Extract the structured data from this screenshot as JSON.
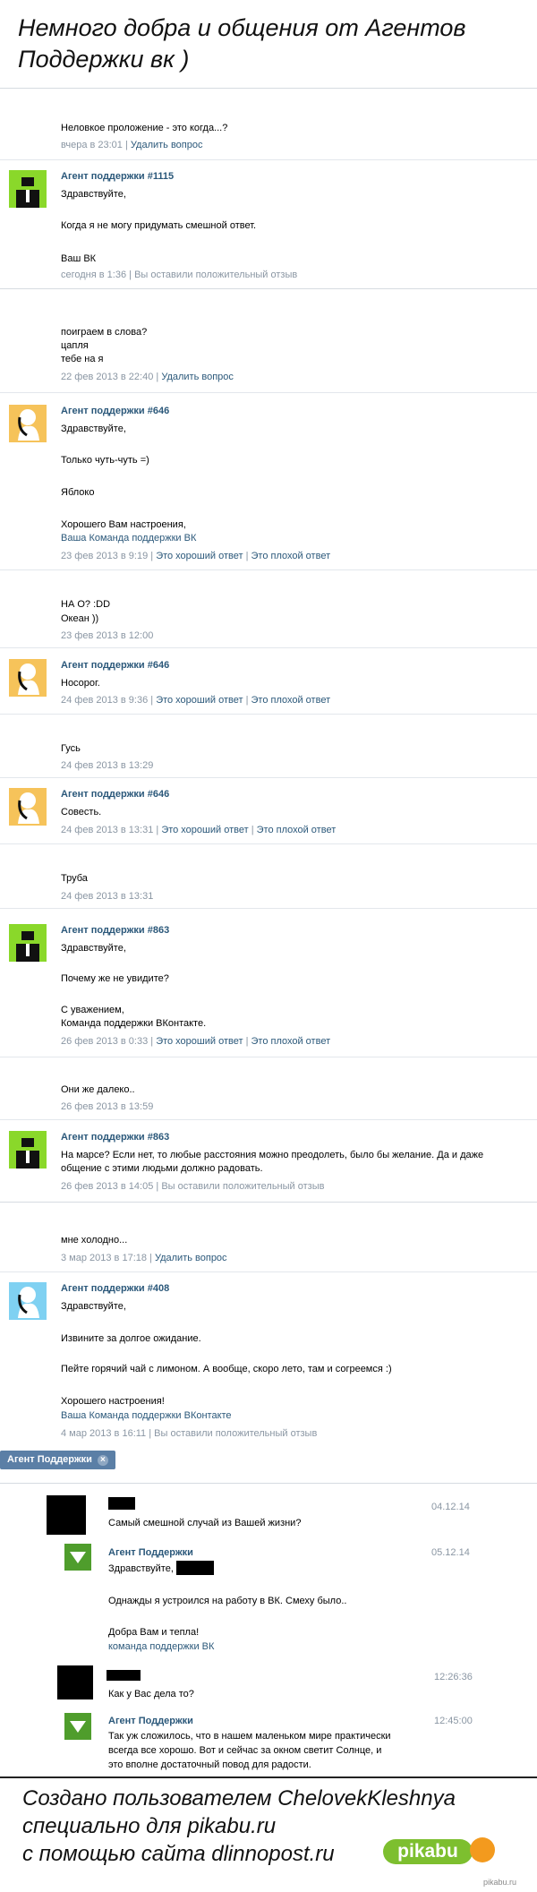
{
  "header": {
    "title": "Немного добра и общения от Агентов Поддержки вк )"
  },
  "conversations": [
    {
      "user_msg": "Неловкое проложение - это когда...?",
      "user_meta_time": "вчера в 23:01",
      "user_meta_action": "Удалить вопрос",
      "agent_name": "Агент поддержки #1115",
      "agent_lines": [
        "Здравствуйте,",
        "Когда я не могу придумать смешной ответ.",
        "Ваш ВК"
      ],
      "agent_meta_time": "сегодня в 1:36",
      "agent_meta_action": "Вы оставили положительный отзыв"
    }
  ],
  "conv2": {
    "q": [
      "поиграем в слова?",
      "цапля",
      "тебе на я"
    ],
    "q_time": "22 фев 2013 в 22:40",
    "q_action": "Удалить вопрос",
    "a1_name": "Агент поддержки #646",
    "a1_lines": [
      "Здравствуйте,",
      "Только чуть-чуть =)",
      "Яблоко",
      "Хорошего Вам настроения,",
      "Ваша Команда поддержки ВК"
    ],
    "a1_time": "23 фев 2013 в 9:19",
    "good": "Это хороший ответ",
    "bad": "Это плохой ответ",
    "q2": [
      "НА О? :DD",
      "Океан ))"
    ],
    "q2_time": "23 фев 2013 в 12:00",
    "a2_name": "Агент поддержки #646",
    "a2_line": "Носорог.",
    "a2_time": "24 фев 2013 в 9:36",
    "q3": "Гусь",
    "q3_time": "24 фев 2013 в 13:29",
    "a3_name": "Агент поддержки #646",
    "a3_line": "Совесть.",
    "a3_time": "24 фев 2013 в 13:31",
    "q4": "Труба",
    "q4_time": "24 фев 2013 в 13:31",
    "a4_name": "Агент поддержки #863",
    "a4_lines": [
      "Здравствуйте,",
      "Почему же не увидите?",
      "С уважением,",
      "Команда поддержки ВКонтакте."
    ],
    "a4_time": "26 фев 2013 в 0:33",
    "q5": "Они же далеко..",
    "q5_time": "26 фев 2013 в 13:59",
    "a5_name": "Агент поддержки #863",
    "a5_lines": [
      "На марсе? Если нет, то любые расстояния можно преодолеть, было бы желание. Да и даже",
      "общение с этими людьми должно радовать."
    ],
    "a5_time": "26 фев 2013 в 14:05",
    "a5_action": "Вы оставили положительный отзыв"
  },
  "conv3": {
    "q": "мне холодно...",
    "q_time": "3 мар 2013 в 17:18",
    "q_action": "Удалить вопрос",
    "a_name": "Агент поддержки #408",
    "a_lines": [
      "Здравствуйте,",
      "Извините за долгое ожидание.",
      "Пейте горячий чай с лимоном. А вообще, скоро лето, там и согреемся :)",
      "Хорошего настроения!",
      "Ваша Команда поддержки ВКонтакте"
    ],
    "a_time": "4 мар 2013 в 16:11",
    "a_action": "Вы оставили положительный отзыв"
  },
  "conv4": {
    "tag": "Агент Поддержки",
    "tag_close": "×",
    "m1": "Самый смешной случай из Вашей жизни?",
    "m1_date": "04.12.14",
    "agent": "Агент Поддержки",
    "a1_date": "05.12.14",
    "a1_greet": "Здравствуйте,",
    "a1_lines": [
      "Однажды я устроился на работу в ВК. Смеху было..",
      "Добра Вам и тепла!"
    ],
    "a1_sign": "команда поддержки ВК",
    "m2": "Как у Вас дела то?",
    "m2_date": "12:26:36",
    "a2_date": "12:45:00",
    "a2_lines": [
      "Так уж сложилось, что в нашем маленьком мире практически",
      "всегда все хорошо. Вот и сейчас за окном светит Солнце, и",
      "это вполне достаточный повод для радости."
    ]
  },
  "footer": {
    "lines": [
      "Создано пользователем ChelovekKleshnya",
      "специально для pikabu.ru",
      "с помощью сайта dlinnopost.ru"
    ],
    "pikabu": "pikabu",
    "pikabu_small": "pikabu.ru"
  },
  "colors": {
    "link": "#2b587a",
    "meta": "#8a96a3",
    "green": "#8ad82a",
    "orange": "#f6c35a",
    "blue": "#7fd1f2"
  }
}
